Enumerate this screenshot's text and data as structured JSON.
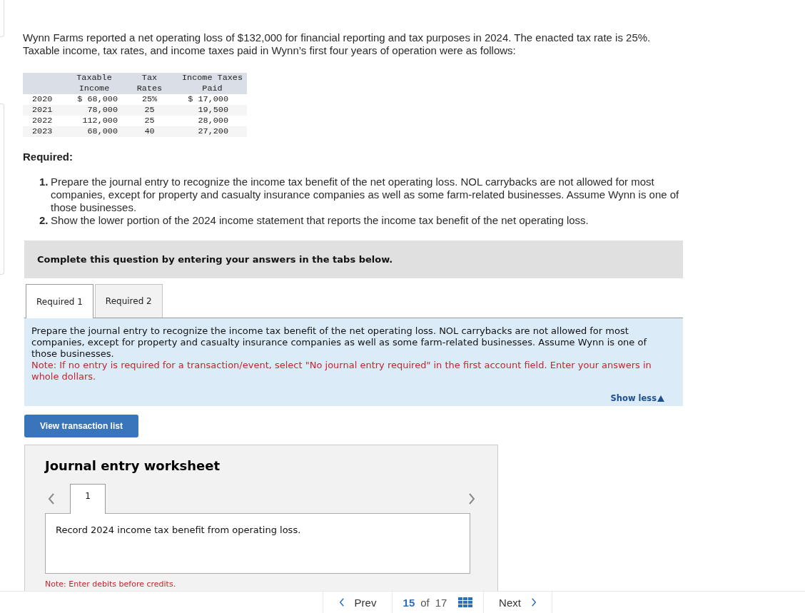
{
  "intro": [
    "Wynn Farms reported a net operating loss of $132,000 for financial reporting and tax purposes in 2024. The enacted tax rate is 25%.",
    "Taxable income, tax rates, and income taxes paid in Wynn’s first four years of operation were as follows:"
  ],
  "table": {
    "columns": [
      "Taxable Income",
      "Tax Rates",
      "Income Taxes Paid"
    ],
    "rows": [
      {
        "year": "2020",
        "taxable_income": "$ 68,000",
        "tax_rate": "25%",
        "taxes_paid": "$ 17,000"
      },
      {
        "year": "2021",
        "taxable_income": "78,000",
        "tax_rate": "25",
        "taxes_paid": "19,500"
      },
      {
        "year": "2022",
        "taxable_income": "112,000",
        "tax_rate": "25",
        "taxes_paid": "28,000"
      },
      {
        "year": "2023",
        "taxable_income": "68,000",
        "tax_rate": "40",
        "taxes_paid": "27,200"
      }
    ]
  },
  "required": {
    "heading": "Required:",
    "items": [
      {
        "number": "1.",
        "text": "Prepare the journal entry to recognize the income tax benefit of the net operating loss. NOL carrybacks are not allowed for most companies, except for property and casualty insurance companies as well as some farm-related businesses. Assume Wynn is one of those businesses."
      },
      {
        "number": "2.",
        "text": "Show the lower portion of the 2024 income statement that reports the income tax benefit of the net operating loss."
      }
    ]
  },
  "instruction_bar": "Complete this question by entering your answers in the tabs below.",
  "tabs": [
    {
      "label": "Required 1",
      "selected": true
    },
    {
      "label": "Required 2",
      "selected": false
    }
  ],
  "info_box": {
    "text": "Prepare the journal entry to recognize the income tax benefit of the net operating loss. NOL carrybacks are not allowed for most companies, except for property and casualty insurance companies as well as some farm-related businesses. Assume Wynn is one of those businesses.",
    "note": "Note: If no entry is required for a transaction/event, select \"No journal entry required\" in the first account field. Enter your answers in whole dollars.",
    "toggle": "Show less"
  },
  "view_button": "View transaction list",
  "worksheet": {
    "title": "Journal entry worksheet",
    "entries": [
      {
        "label": "1",
        "selected": true
      }
    ],
    "description": "Record 2024 income tax benefit from operating loss.",
    "note": "Note: Enter debits before credits."
  },
  "pager": {
    "prev": "Prev",
    "current": "15",
    "separator": "of",
    "total": "17",
    "next": "Next"
  }
}
